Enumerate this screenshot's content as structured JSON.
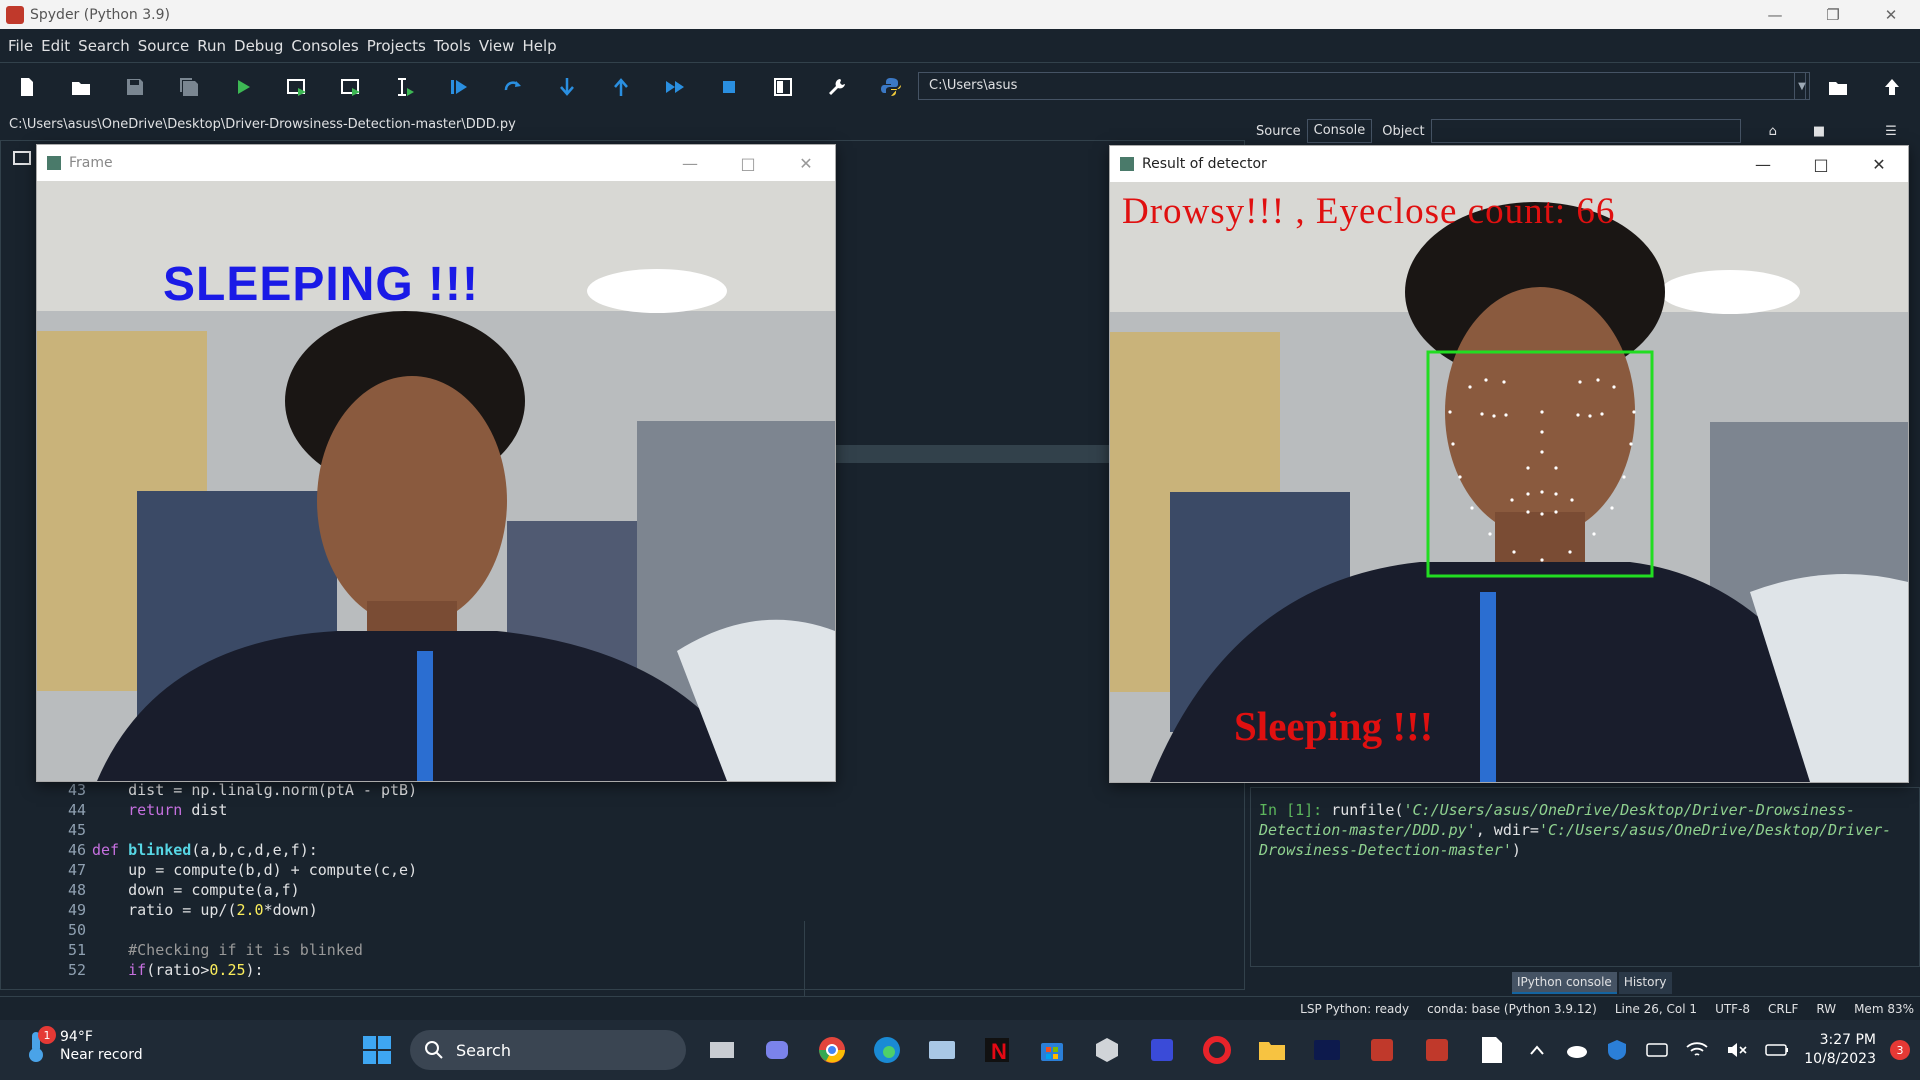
{
  "window": {
    "title": "Spyder (Python 3.9)"
  },
  "menu": [
    "File",
    "Edit",
    "Search",
    "Source",
    "Run",
    "Debug",
    "Consoles",
    "Projects",
    "Tools",
    "View",
    "Help"
  ],
  "toolbar": {
    "working_dir": "C:\\Users\\asus"
  },
  "editor": {
    "file_path": "C:\\Users\\asus\\OneDrive\\Desktop\\Driver-Drowsiness-Detection-master\\DDD.py",
    "line_numbers": [
      "43",
      "44",
      "45",
      "46",
      "47",
      "48",
      "49",
      "50",
      "51",
      "52"
    ],
    "lines": [
      "    dist = np.linalg.norm(ptA - ptB)",
      "    return dist",
      "",
      "def blinked(a,b,c,d,e,f):",
      "    up = compute(b,d) + compute(c,e)",
      "    down = compute(a,f)",
      "    ratio = up/(2.0*down)",
      "",
      "    #Checking if it is blinked",
      "    if(ratio>0.25):"
    ]
  },
  "help_bar": {
    "source_label": "Source",
    "source_value": "Console",
    "object_label": "Object"
  },
  "console": {
    "prompt": "In [1]:",
    "command": "runfile(",
    "arg1": "'C:/Users/asus/OneDrive/Desktop/Driver-Drowsiness-Detection-master/DDD.py'",
    "sep": ", wdir=",
    "arg2": "'C:/Users/asus/OneDrive/Desktop/Driver-Drowsiness-Detection-master'",
    "close": ")",
    "tabs": [
      "IPython console",
      "History"
    ]
  },
  "statusbar": {
    "lsp": "LSP Python: ready",
    "conda": "conda: base (Python 3.9.12)",
    "position": "Line 26, Col 1",
    "encoding": "UTF-8",
    "eol": "CRLF",
    "mode": "RW",
    "mem": "Mem 83%"
  },
  "frame_window": {
    "title": "Frame",
    "overlay_text": "SLEEPING !!!"
  },
  "detector_window": {
    "title": "Result of detector",
    "top_text": "Drowsy!!! , Eyeclose count: 66",
    "bottom_text": "Sleeping !!!"
  },
  "taskbar": {
    "weather_temp": "94°F",
    "weather_desc": "Near record",
    "weather_badge": "1",
    "search_label": "Search",
    "time": "3:27 PM",
    "date": "10/8/2023",
    "notifications": "3"
  },
  "colors": {
    "spyder_bg": "#19232d",
    "overlay_blue": "#1a1ae6",
    "overlay_red": "#e01010",
    "face_box": "#22dd22"
  }
}
